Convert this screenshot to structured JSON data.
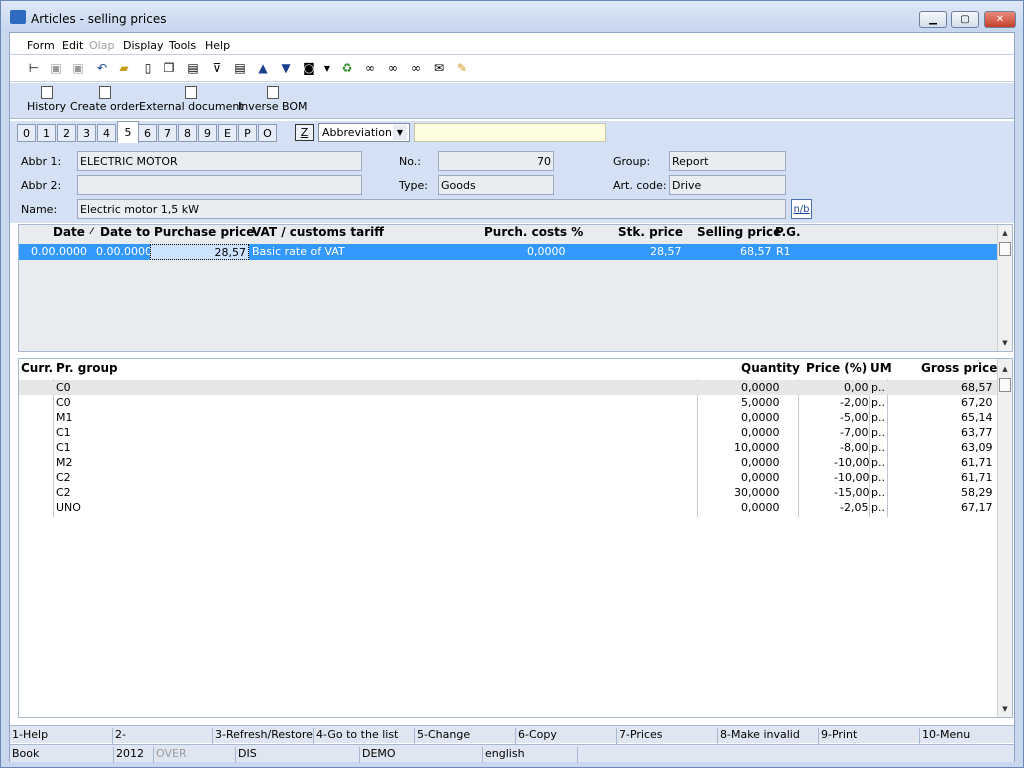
{
  "window": {
    "title": "Articles - selling prices"
  },
  "menu": [
    "Form",
    "Edit",
    "Olap",
    "Display",
    "Tools",
    "Help"
  ],
  "toolbar_icons": [
    "tree-icon",
    "save-icon",
    "save-as-icon",
    "undo-icon",
    "open-folder-icon",
    "new-document-icon",
    "copy-icon",
    "book-icon",
    "filter-icon",
    "filter-document-icon",
    "arrow-up-icon",
    "arrow-down-icon",
    "camera-icon",
    "dropdown-icon",
    "recycle-icon",
    "binoculars-icon",
    "binoculars-next-icon",
    "binoculars-prev-icon",
    "mail-icon",
    "notepad-icon"
  ],
  "actions": [
    "History",
    "Create order",
    "External document",
    "Inverse BOM"
  ],
  "tabs": [
    "0",
    "1",
    "2",
    "3",
    "4",
    "5",
    "6",
    "7",
    "8",
    "9",
    "E",
    "P",
    "O"
  ],
  "active_tab": "5",
  "z_button": "Z",
  "abbreviation_select": "Abbreviation1",
  "form": {
    "abbr1_label": "Abbr 1:",
    "abbr1": "ELECTRIC MOTOR",
    "abbr2_label": "Abbr 2:",
    "abbr2": "",
    "name_label": "Name:",
    "name": "Electric motor 1,5 kW",
    "no_label": "No.:",
    "no": "70",
    "type_label": "Type:",
    "type": "Goods",
    "group_label": "Group:",
    "group": "Report",
    "artcode_label": "Art. code:",
    "artcode": "Drive",
    "nb_button": "n/b"
  },
  "price_grid": {
    "headers": [
      "Date",
      "Date to",
      "Purchase price",
      "VAT / customs tariff",
      "Purch. costs %",
      "Stk. price",
      "Selling price",
      "P.G."
    ],
    "row": [
      "0.00.0000",
      "0.00.0000",
      "28,57",
      "Basic rate of VAT",
      "0,0000",
      "28,57",
      "68,57",
      "R1"
    ]
  },
  "group_grid": {
    "headers": [
      "Curr.",
      "Pr. group",
      "Quantity",
      "Price (%)",
      "UM",
      "Gross price"
    ],
    "rows": [
      {
        "group": "C0",
        "qty": "0,0000",
        "pct": "0,00",
        "um": "p..",
        "gross": "68,57"
      },
      {
        "group": "C0",
        "qty": "5,0000",
        "pct": "-2,00",
        "um": "p..",
        "gross": "67,20"
      },
      {
        "group": "M1",
        "qty": "0,0000",
        "pct": "-5,00",
        "um": "p..",
        "gross": "65,14"
      },
      {
        "group": "C1",
        "qty": "0,0000",
        "pct": "-7,00",
        "um": "p..",
        "gross": "63,77"
      },
      {
        "group": "C1",
        "qty": "10,0000",
        "pct": "-8,00",
        "um": "p..",
        "gross": "63,09"
      },
      {
        "group": "M2",
        "qty": "0,0000",
        "pct": "-10,00",
        "um": "p..",
        "gross": "61,71"
      },
      {
        "group": "C2",
        "qty": "0,0000",
        "pct": "-10,00",
        "um": "p..",
        "gross": "61,71"
      },
      {
        "group": "C2",
        "qty": "30,0000",
        "pct": "-15,00",
        "um": "p..",
        "gross": "58,29"
      },
      {
        "group": "UNO",
        "qty": "0,0000",
        "pct": "-2,05",
        "um": "p..",
        "gross": "67,17"
      }
    ]
  },
  "fkeys": [
    "1-Help",
    "2-",
    "3-Refresh/Restore",
    "4-Go to the list",
    "5-Change",
    "6-Copy",
    "7-Prices",
    "8-Make invalid",
    "9-Print",
    "10-Menu"
  ],
  "status": [
    "Book",
    "2012",
    "OVER",
    "DIS",
    "DEMO",
    "english"
  ]
}
